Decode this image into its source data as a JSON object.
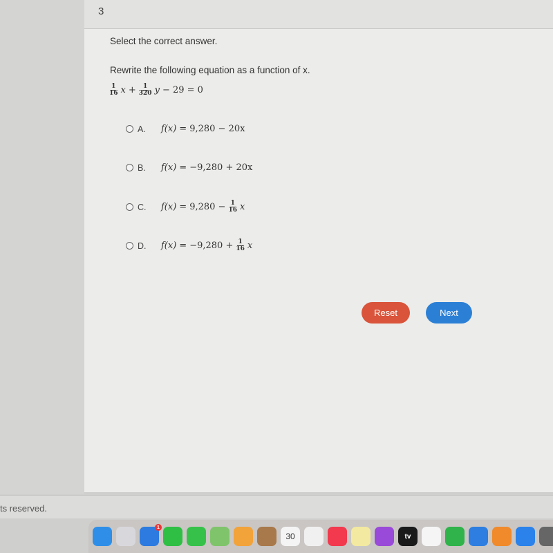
{
  "question_number": "3",
  "instruction": "Select the correct answer.",
  "prompt": "Rewrite the following equation as a function of x.",
  "equation": {
    "t1_num": "1",
    "t1_den": "16",
    "t1_var": "x",
    "plus": "+",
    "t2_num": "1",
    "t2_den": "320",
    "t2_var": "y",
    "rest": "− 29 = 0"
  },
  "options": [
    {
      "label": "A.",
      "lhs": "f(x)",
      "eq": "=",
      "rhs": "9,280 − 20x"
    },
    {
      "label": "B.",
      "lhs": "f(x)",
      "eq": "=",
      "rhs": "−9,280 + 20x"
    },
    {
      "label": "C.",
      "lhs": "f(x)",
      "eq": "=",
      "rhs": "9,280 −",
      "frac_num": "1",
      "frac_den": "16",
      "var": "x"
    },
    {
      "label": "D.",
      "lhs": "f(x)",
      "eq": "=",
      "rhs": "−9,280 +",
      "frac_num": "1",
      "frac_den": "16",
      "var": "x"
    }
  ],
  "buttons": {
    "reset": "Reset",
    "next": "Next",
    "reset_color": "#d9543a",
    "next_color": "#2b80d6"
  },
  "footer": "ts reserved.",
  "dock": {
    "icons": [
      "finder",
      "launchpad",
      "mail",
      "facetime",
      "messages",
      "maps",
      "photos",
      "contacts",
      "calendar",
      "reminders",
      "music",
      "notes",
      "podcasts",
      "apple-tv",
      "news",
      "numbers",
      "keynote",
      "pages",
      "app-store",
      "system-preferences"
    ],
    "mail_badge": "1",
    "calendar_day": "30",
    "tv_label": "tv"
  }
}
